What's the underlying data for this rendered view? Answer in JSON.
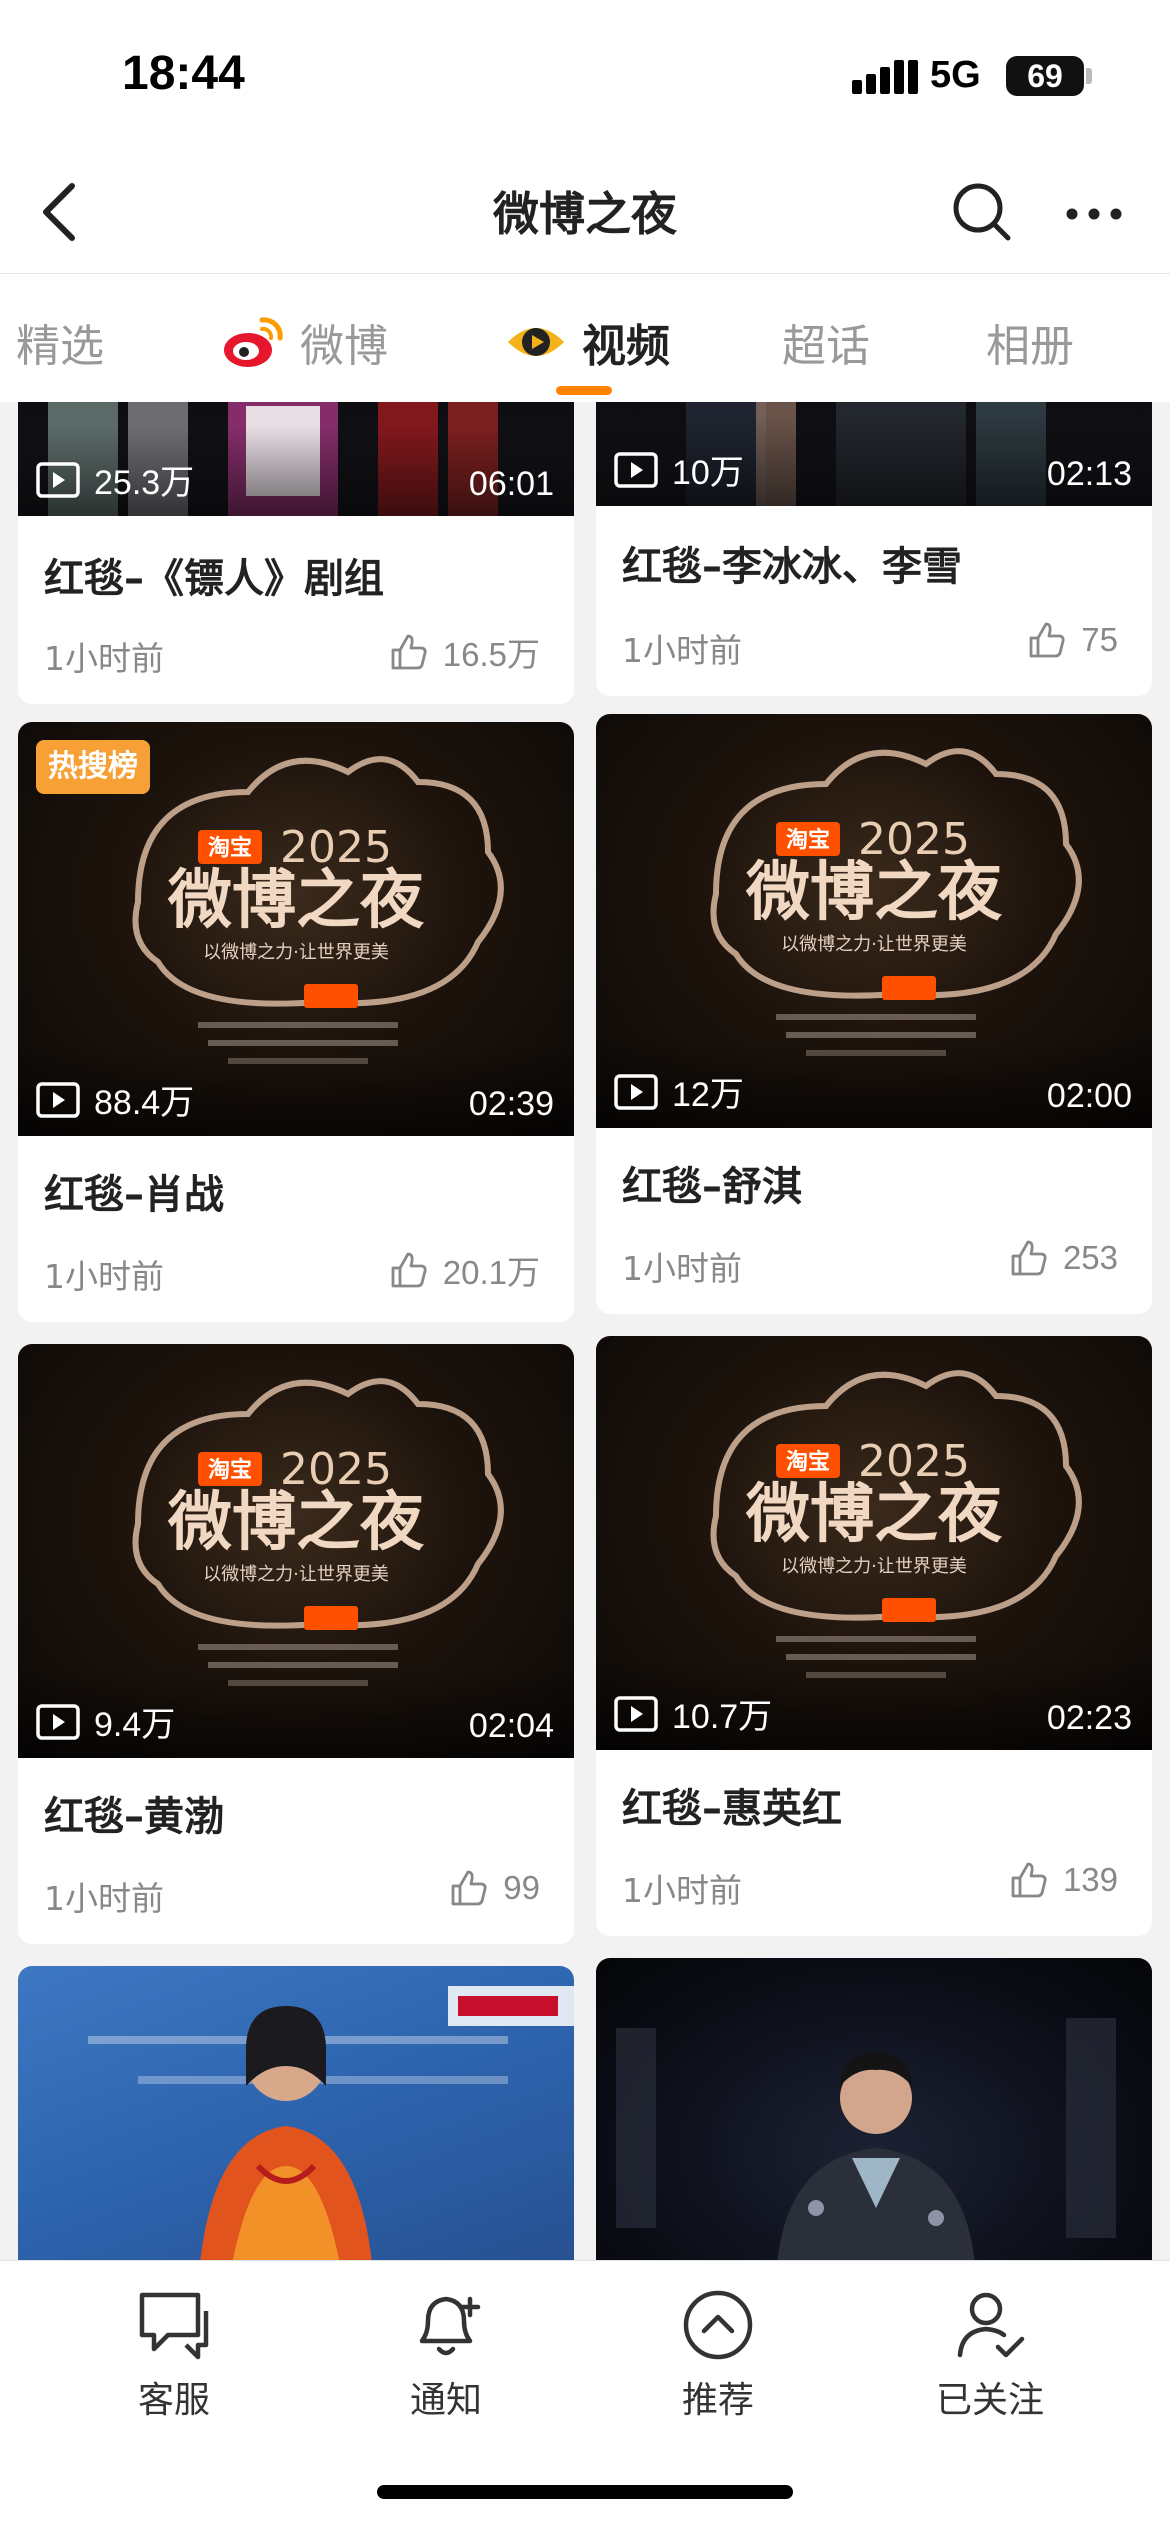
{
  "status_bar": {
    "time": "18:44",
    "network": "5G",
    "battery": "69"
  },
  "header": {
    "title": "微博之夜"
  },
  "tabs": [
    {
      "label": "精选"
    },
    {
      "label": "微博"
    },
    {
      "label": "视频"
    },
    {
      "label": "超话"
    },
    {
      "label": "相册"
    }
  ],
  "active_tab": "视频",
  "logo_text": {
    "brand": "淘宝",
    "year": "2025",
    "name": "微博之夜",
    "slogan": "以微博之力·让世界更美"
  },
  "cards": [
    {
      "title": "红毯–《镖人》剧组",
      "plays": "25.3万",
      "duration": "06:01",
      "time": "1小时前",
      "likes": "16.5万"
    },
    {
      "title": "红毯–李冰冰、李雪",
      "plays": "10万",
      "duration": "02:13",
      "time": "1小时前",
      "likes": "75"
    },
    {
      "title": "红毯–肖战",
      "plays": "88.4万",
      "duration": "02:39",
      "time": "1小时前",
      "likes": "20.1万",
      "badge": "热搜榜"
    },
    {
      "title": "红毯–舒淇",
      "plays": "12万",
      "duration": "02:00",
      "time": "1小时前",
      "likes": "253"
    },
    {
      "title": "红毯–黄渤",
      "plays": "9.4万",
      "duration": "02:04",
      "time": "1小时前",
      "likes": "99"
    },
    {
      "title": "红毯–惠英红",
      "plays": "10.7万",
      "duration": "02:23",
      "time": "1小时前",
      "likes": "139"
    }
  ],
  "bottom_nav": [
    {
      "label": "客服",
      "icon": "chat-icon"
    },
    {
      "label": "通知",
      "icon": "bell-plus-icon"
    },
    {
      "label": "推荐",
      "icon": "chevron-up-circle-icon"
    },
    {
      "label": "已关注",
      "icon": "user-check-icon"
    }
  ],
  "colors": {
    "accent": "#ff8200",
    "badge": "#f7a035",
    "background": "#f2f2f2"
  }
}
